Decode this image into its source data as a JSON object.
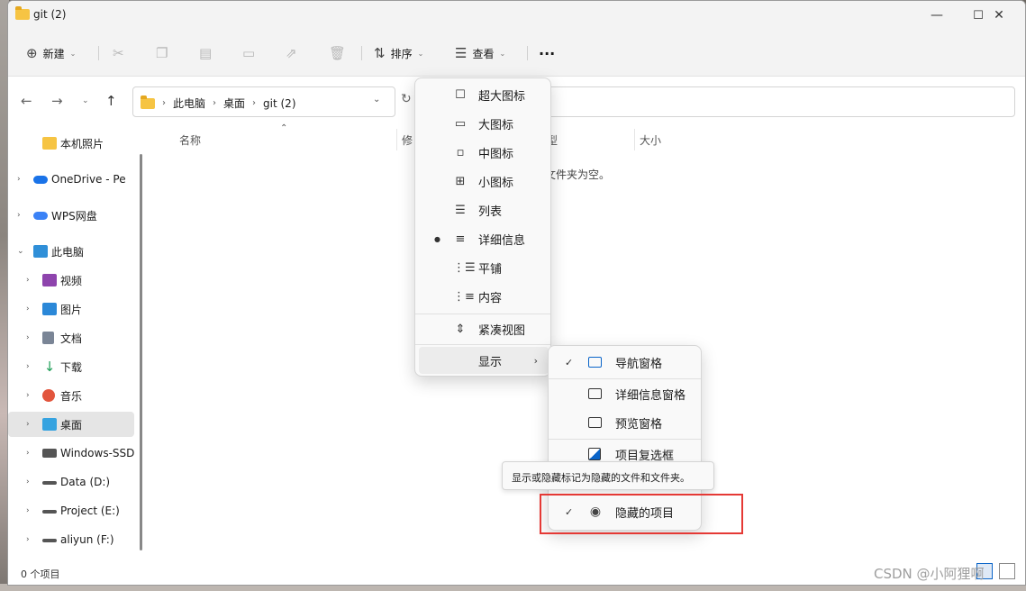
{
  "window": {
    "title": "git (2)"
  },
  "window_controls": {
    "minimize": "—",
    "maximize": "☐",
    "close": "✕"
  },
  "toolbar": {
    "new_label": "新建",
    "sort_label": "排序",
    "view_label": "查看",
    "more_label": "···"
  },
  "address": {
    "segments": [
      "此电脑",
      "桌面",
      "git (2)"
    ]
  },
  "sidebar": {
    "items": [
      {
        "label": "本机照片",
        "color": "#f6c443"
      },
      {
        "label": "OneDrive - Pers",
        "color": "#1a73e8"
      },
      {
        "label": "WPS网盘",
        "color": "#3b82f6"
      },
      {
        "label": "此电脑",
        "color": "#2f8fd8"
      },
      {
        "label": "视频",
        "color": "#8e44ad"
      },
      {
        "label": "图片",
        "color": "#2b88d8"
      },
      {
        "label": "文档",
        "color": "#7a8596"
      },
      {
        "label": "下载",
        "color": "#1e9e57"
      },
      {
        "label": "音乐",
        "color": "#e2553d"
      },
      {
        "label": "桌面",
        "color": "#36a3e0"
      },
      {
        "label": "Windows-SSD",
        "color": "#555555"
      },
      {
        "label": "Data (D:)",
        "color": "#555555"
      },
      {
        "label": "Project (E:)",
        "color": "#555555"
      },
      {
        "label": "aliyun (F:)",
        "color": "#555555"
      }
    ]
  },
  "columns": {
    "name": "名称",
    "modified": "修",
    "type": "型",
    "size": "大小"
  },
  "content": {
    "empty_text": "此文件夹为空。"
  },
  "status": {
    "item_count": "0 个项目"
  },
  "view_menu": {
    "items": [
      {
        "label": "超大图标",
        "icon": "☐"
      },
      {
        "label": "大图标",
        "icon": "▭"
      },
      {
        "label": "中图标",
        "icon": "▫"
      },
      {
        "label": "小图标",
        "icon": "⊞"
      },
      {
        "label": "列表",
        "icon": "☰"
      },
      {
        "label": "详细信息",
        "icon": "≡"
      },
      {
        "label": "平铺",
        "icon": "⋮☰"
      },
      {
        "label": "内容",
        "icon": "⋮≡"
      },
      {
        "label": "紧凑视图",
        "icon": "⇕"
      }
    ],
    "show_label": "显示"
  },
  "show_submenu": {
    "items": [
      {
        "label": "导航窗格",
        "checked": true
      },
      {
        "label": "详细信息窗格",
        "checked": false
      },
      {
        "label": "预览窗格",
        "checked": false
      },
      {
        "label": "项目复选框",
        "checked": false
      },
      {
        "label": "隐藏的项目",
        "checked": true
      }
    ]
  },
  "tooltip": {
    "text": "显示或隐藏标记为隐藏的文件和文件夹。"
  },
  "watermark": {
    "text": "CSDN @小阿狸啊"
  },
  "colors": {
    "highlight_box": "#e53935",
    "folder": "#f6c443",
    "checkbox_blue": "#0a64c8"
  }
}
